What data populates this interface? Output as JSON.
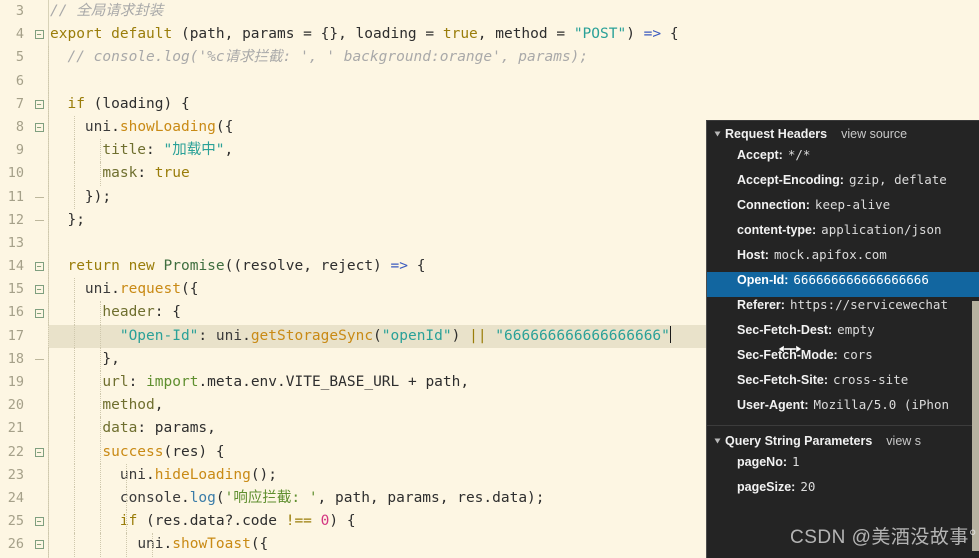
{
  "editor": {
    "theme_background": "#fdf6e3",
    "selection_background": "#e9e2ca",
    "selected_line": 17,
    "lines": [
      {
        "num": "3",
        "fold": "none",
        "indent": 0
      },
      {
        "num": "4",
        "fold": "box",
        "indent": 0
      },
      {
        "num": "5",
        "fold": "none",
        "indent": 1
      },
      {
        "num": "6",
        "fold": "none",
        "indent": 1
      },
      {
        "num": "7",
        "fold": "box",
        "indent": 1
      },
      {
        "num": "8",
        "fold": "box",
        "indent": 2
      },
      {
        "num": "9",
        "fold": "none",
        "indent": 3
      },
      {
        "num": "10",
        "fold": "none",
        "indent": 3
      },
      {
        "num": "11",
        "fold": "tick",
        "indent": 2
      },
      {
        "num": "12",
        "fold": "tick",
        "indent": 1
      },
      {
        "num": "13",
        "fold": "none",
        "indent": 1
      },
      {
        "num": "14",
        "fold": "box",
        "indent": 1
      },
      {
        "num": "15",
        "fold": "box",
        "indent": 2
      },
      {
        "num": "16",
        "fold": "box",
        "indent": 3
      },
      {
        "num": "17",
        "fold": "none",
        "indent": 4
      },
      {
        "num": "18",
        "fold": "tick",
        "indent": 3
      },
      {
        "num": "19",
        "fold": "none",
        "indent": 3
      },
      {
        "num": "20",
        "fold": "none",
        "indent": 3
      },
      {
        "num": "21",
        "fold": "none",
        "indent": 3
      },
      {
        "num": "22",
        "fold": "box",
        "indent": 3
      },
      {
        "num": "23",
        "fold": "none",
        "indent": 4
      },
      {
        "num": "24",
        "fold": "none",
        "indent": 4
      },
      {
        "num": "25",
        "fold": "box",
        "indent": 4
      },
      {
        "num": "26",
        "fold": "box",
        "indent": 5
      }
    ],
    "code": {
      "l3": "// 全局请求封装",
      "l4": "export default (path, params = {}, loading = true, method = \"POST\") => {",
      "l5": "// console.log('%c请求拦截: ', ' background:orange', params);",
      "l6": "",
      "l7": "if (loading) {",
      "l8": "uni.showLoading({",
      "l9": "title: \"加载中\",",
      "l10": "mask: true",
      "l11": "});",
      "l12": "};",
      "l13": "",
      "l14": "return new Promise((resolve, reject) => {",
      "l15": "uni.request({",
      "l16": "header: {",
      "l17": "\"Open-Id\": uni.getStorageSync(\"openId\") || \"666666666666666666\"",
      "l18": "},",
      "l19": "url: import.meta.env.VITE_BASE_URL + path,",
      "l20": "method,",
      "l21": "data: params,",
      "l22": "success(res) {",
      "l23": "uni.hideLoading();",
      "l24": "console.log('响应拦截: ', path, params, res.data);",
      "l25": "if (res.data?.code !== 0) {",
      "l26": "uni.showToast({"
    },
    "tokens": {
      "comment3": "// 全局请求封装",
      "kw_export": "export",
      "kw_default": "default",
      "str_post": "\"POST\"",
      "bool_true": "true",
      "arrow": "=>",
      "comment5": "// console.log('%c请求拦截: ', ' background:orange', params);",
      "kw_if": "if",
      "kw_return": "return",
      "kw_new": "new",
      "promise": "Promise",
      "uni": "uni",
      "showLoading": "showLoading",
      "request": "request",
      "getStorageSync": "getStorageSync",
      "hideLoading": "hideLoading",
      "showToast": "showToast",
      "str_loading_title": "\"加载中\"",
      "str_openid_key": "\"Open-Id\"",
      "str_openid_arg": "\"openId\"",
      "str_openid_fallback": "\"666666666666666666\"",
      "str_resp_log": "'响应拦截: '",
      "num_zero": "0",
      "import_kw": "import",
      "vite_base_url": "VITE_BASE_URL",
      "console": "console",
      "log": "log",
      "success": "success"
    }
  },
  "devtools": {
    "sections": [
      {
        "title": "Request Headers",
        "view_source_label": "view source",
        "rows": [
          {
            "key": "Accept:",
            "value": "*/*",
            "selected": false
          },
          {
            "key": "Accept-Encoding:",
            "value": "gzip, deflate",
            "selected": false
          },
          {
            "key": "Connection:",
            "value": "keep-alive",
            "selected": false
          },
          {
            "key": "content-type:",
            "value": "application/json",
            "selected": false
          },
          {
            "key": "Host:",
            "value": "mock.apifox.com",
            "selected": false
          },
          {
            "key": "Open-Id:",
            "value": "666666666666666666",
            "selected": true
          },
          {
            "key": "Referer:",
            "value": "https://servicewechat",
            "selected": false
          },
          {
            "key": "Sec-Fetch-Dest:",
            "value": "empty",
            "selected": false
          },
          {
            "key": "Sec-Fetch-Mode:",
            "value": "cors",
            "selected": false
          },
          {
            "key": "Sec-Fetch-Site:",
            "value": "cross-site",
            "selected": false
          },
          {
            "key": "User-Agent:",
            "value": "Mozilla/5.0 (iPhon",
            "selected": false
          }
        ]
      },
      {
        "title": "Query String Parameters",
        "view_source_label": "view s",
        "rows": [
          {
            "key": "pageNo:",
            "value": "1",
            "selected": false
          },
          {
            "key": "pageSize:",
            "value": "20",
            "selected": false
          }
        ]
      }
    ],
    "selection_color": "#1266a0",
    "background": "#242424"
  },
  "watermark": {
    "text": "CSDN @美酒没故事°"
  }
}
